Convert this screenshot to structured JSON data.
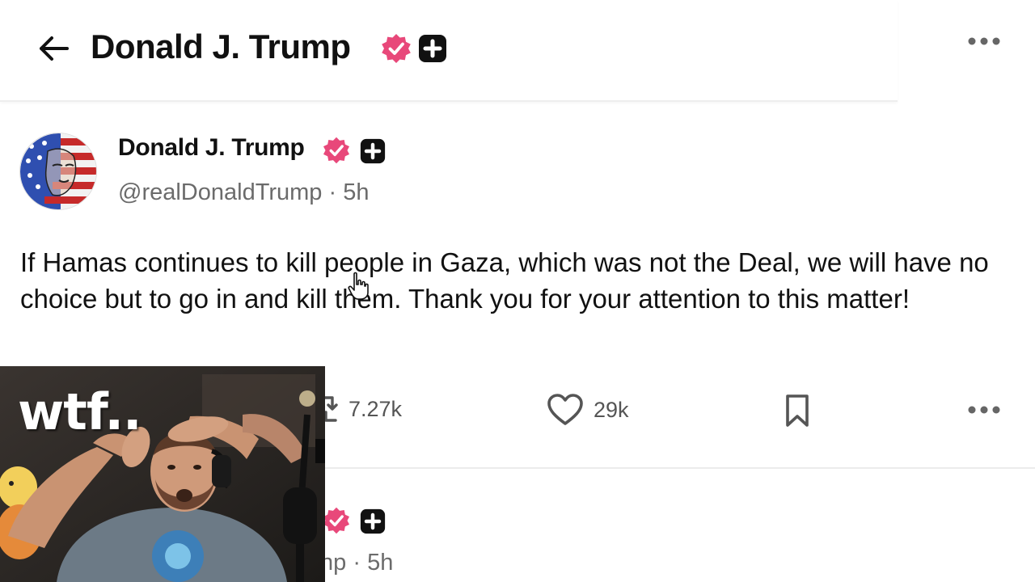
{
  "header": {
    "title": "Donald J. Trump"
  },
  "post": {
    "author_name": "Donald J. Trump",
    "handle": "@realDonaldTrump",
    "separator": "·",
    "time": "5h",
    "text": "If Hamas continues to kill people in Gaza, which was not the Deal, we will have no choice but to go in and kill them. Thank you for your attention to this matter!",
    "actions": {
      "reposts": "7.27k",
      "likes": "29k"
    }
  },
  "next_post": {
    "handle_partial": "np",
    "separator": "·",
    "time": "5h"
  },
  "webcam": {
    "caption": "wtf.."
  },
  "colors": {
    "verified_pink": "#e8487a",
    "icon_dark": "#111111",
    "muted_text": "#6b6b6b"
  }
}
